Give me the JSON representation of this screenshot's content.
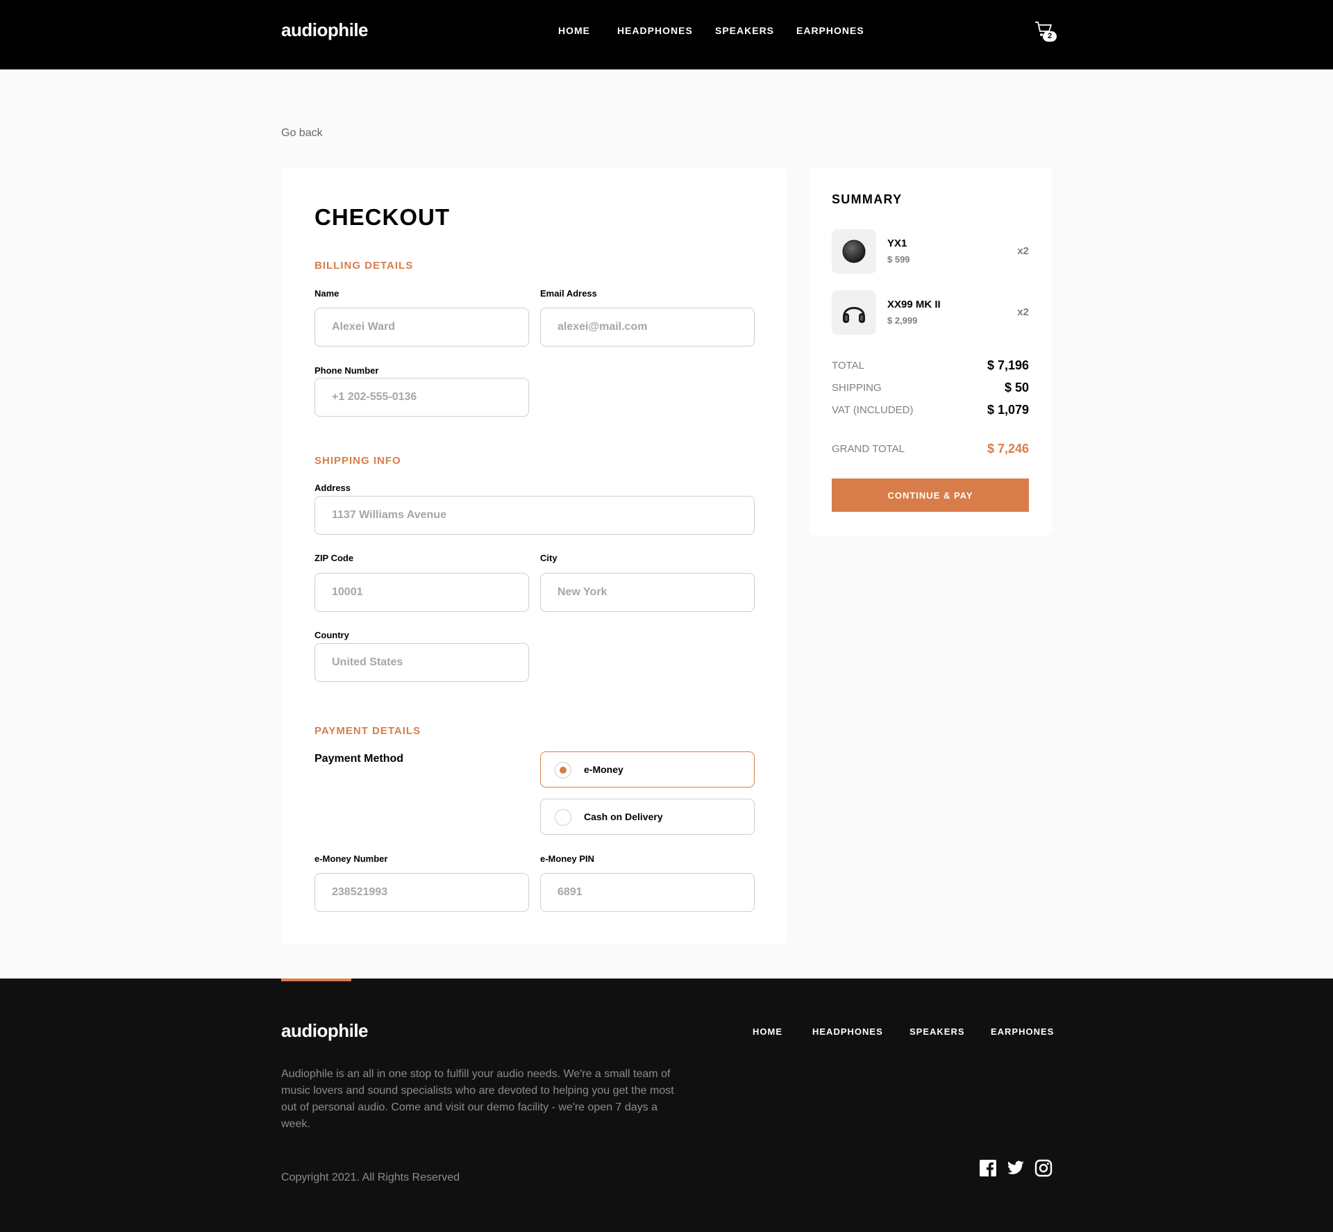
{
  "header": {
    "logo": "audiophile",
    "nav": [
      "HOME",
      "HEADPHONES",
      "SPEAKERS",
      "EARPHONES"
    ],
    "cart_count": "2",
    "cart_icon": "cart-icon"
  },
  "go_back": "Go back",
  "checkout": {
    "title": "CHECKOUT",
    "billing": {
      "title": "BILLING DETAILS",
      "name_label": "Name",
      "name_placeholder": "Alexei Ward",
      "email_label": "Email Adress",
      "email_placeholder": "alexei@mail.com",
      "phone_label": "Phone Number",
      "phone_placeholder": "+1 202-555-0136"
    },
    "shipping": {
      "title": "SHIPPING INFO",
      "address_label": "Address",
      "address_placeholder": "1137 Williams Avenue",
      "zip_label": "ZIP Code",
      "zip_placeholder": "10001",
      "city_label": "City",
      "city_placeholder": "New York",
      "country_label": "Country",
      "country_placeholder": "United States"
    },
    "payment": {
      "title": "PAYMENT DETAILS",
      "method_label": "Payment Method",
      "options": [
        "e-Money",
        "Cash on Delivery"
      ],
      "selected": "e-Money",
      "emoney_number_label": "e-Money Number",
      "emoney_number_placeholder": "238521993",
      "emoney_pin_label": "e-Money PIN",
      "emoney_pin_placeholder": "6891"
    }
  },
  "summary": {
    "title": "SUMMARY",
    "items": [
      {
        "name": "YX1",
        "price": "$ 599",
        "qty": "x2",
        "icon": "earphones-icon"
      },
      {
        "name": "XX99 MK II",
        "price": "$ 2,999",
        "qty": "x2",
        "icon": "headphones-icon"
      }
    ],
    "total_label": "TOTAL",
    "total": "$ 7,196",
    "shipping_label": "SHIPPING",
    "shipping": "$ 50",
    "vat_label": "VAT (INCLUDED)",
    "vat": "$ 1,079",
    "grand_total_label": "GRAND TOTAL",
    "grand_total": "$ 7,246",
    "button": "CONTINUE & PAY"
  },
  "footer": {
    "logo": "audiophile",
    "nav": [
      "HOME",
      "HEADPHONES",
      "SPEAKERS",
      "EARPHONES"
    ],
    "description": "Audiophile is an all in one stop to fulfill your audio needs. We're a small team of music lovers and sound specialists who are devoted to helping you get the most out of personal audio. Come and visit our demo facility - we're open 7 days a week.",
    "copyright": "Copyright 2021. All Rights Reserved",
    "social": [
      "facebook-icon",
      "twitter-icon",
      "instagram-icon"
    ]
  },
  "colors": {
    "accent": "#d87d4a",
    "header_bg": "#000000",
    "footer_bg": "#101010",
    "page_bg": "#fafafa"
  }
}
